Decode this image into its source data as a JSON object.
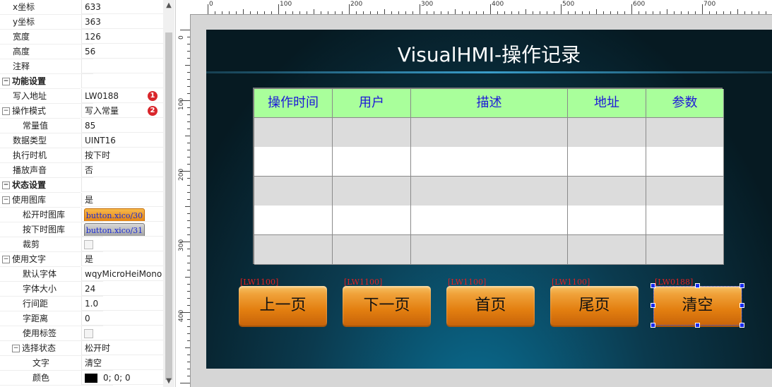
{
  "props": [
    {
      "key": "x坐标",
      "value": "633",
      "section": false,
      "expander": "",
      "indent": 1
    },
    {
      "key": "y坐标",
      "value": "363",
      "section": false,
      "expander": "",
      "indent": 1
    },
    {
      "key": "宽度",
      "value": "126",
      "section": false,
      "expander": "",
      "indent": 1
    },
    {
      "key": "高度",
      "value": "56",
      "section": false,
      "expander": "",
      "indent": 1
    },
    {
      "key": "注释",
      "value": "",
      "section": false,
      "expander": "",
      "indent": 1
    },
    {
      "key": "功能设置",
      "value": "",
      "section": true,
      "expander": "⊟",
      "indent": 0
    },
    {
      "key": "写入地址",
      "value": "LW0188",
      "section": false,
      "expander": "",
      "indent": 1,
      "badge": "1"
    },
    {
      "key": "操作模式",
      "value": "写入常量",
      "section": false,
      "expander": "⊟",
      "indent": 0,
      "badge": "2"
    },
    {
      "key": "常量值",
      "value": "85",
      "section": false,
      "expander": "",
      "indent": 2
    },
    {
      "key": "数据类型",
      "value": "UINT16",
      "section": false,
      "expander": "",
      "indent": 1
    },
    {
      "key": "执行时机",
      "value": "按下时",
      "section": false,
      "expander": "",
      "indent": 1
    },
    {
      "key": "播放声音",
      "value": "否",
      "section": false,
      "expander": "",
      "indent": 1
    },
    {
      "key": "状态设置",
      "value": "",
      "section": true,
      "expander": "⊟",
      "indent": 0
    },
    {
      "key": "使用图库",
      "value": "是",
      "section": false,
      "expander": "⊟",
      "indent": 0
    },
    {
      "key": "松开时图库",
      "value": "button.xico/30",
      "section": false,
      "expander": "",
      "indent": 2,
      "imgbtn": "up"
    },
    {
      "key": "按下时图库",
      "value": "button.xico/31",
      "section": false,
      "expander": "",
      "indent": 2,
      "imgbtn": "down"
    },
    {
      "key": "裁剪",
      "value": "",
      "section": false,
      "expander": "",
      "indent": 2,
      "checkbox": true
    },
    {
      "key": "使用文字",
      "value": "是",
      "section": false,
      "expander": "⊟",
      "indent": 0
    },
    {
      "key": "默认字体",
      "value": "wqyMicroHeiMono",
      "section": false,
      "expander": "",
      "indent": 2
    },
    {
      "key": "字体大小",
      "value": "24",
      "section": false,
      "expander": "",
      "indent": 2
    },
    {
      "key": "行间距",
      "value": "1.0",
      "section": false,
      "expander": "",
      "indent": 2
    },
    {
      "key": "字距离",
      "value": "0",
      "section": false,
      "expander": "",
      "indent": 2
    },
    {
      "key": "使用标签",
      "value": "",
      "section": false,
      "expander": "",
      "indent": 2,
      "checkbox": true
    },
    {
      "key": "选择状态",
      "value": "松开时",
      "section": false,
      "expander": "⊟",
      "indent": 1
    },
    {
      "key": "文字",
      "value": "清空",
      "section": false,
      "expander": "",
      "indent": 3
    },
    {
      "key": "颜色",
      "value": "0; 0; 0",
      "section": false,
      "expander": "",
      "indent": 3,
      "swatch": "#000000"
    }
  ],
  "ruler": {
    "h_labels": [
      "0",
      "100",
      "200",
      "300",
      "400",
      "500",
      "600",
      "700"
    ],
    "v_labels": [
      "0",
      "100",
      "200",
      "300",
      "400"
    ]
  },
  "screen": {
    "title": "VisualHMI-操作记录",
    "table_headers": [
      "操作时间",
      "用户",
      "描述",
      "地址",
      "参数"
    ],
    "row_count": 5
  },
  "buttons": [
    {
      "label": "上一页",
      "address": "[LW1100]"
    },
    {
      "label": "下一页",
      "address": "[LW1100]"
    },
    {
      "label": "首页",
      "address": "[LW1100]"
    },
    {
      "label": "尾页",
      "address": "[LW1100]"
    },
    {
      "label": "清空",
      "address": "[LW0188]"
    }
  ],
  "colors": {
    "header_bg": "#a9ff9b",
    "header_text": "#1c17d8",
    "row_alt": "#dcdcdc",
    "row_plain": "#ffffff",
    "button": "#e88a1a",
    "address_text": "#e02020",
    "selection": "#1a2cf0"
  },
  "icons": {
    "scroll_up": "▲",
    "scroll_down": "▼"
  }
}
